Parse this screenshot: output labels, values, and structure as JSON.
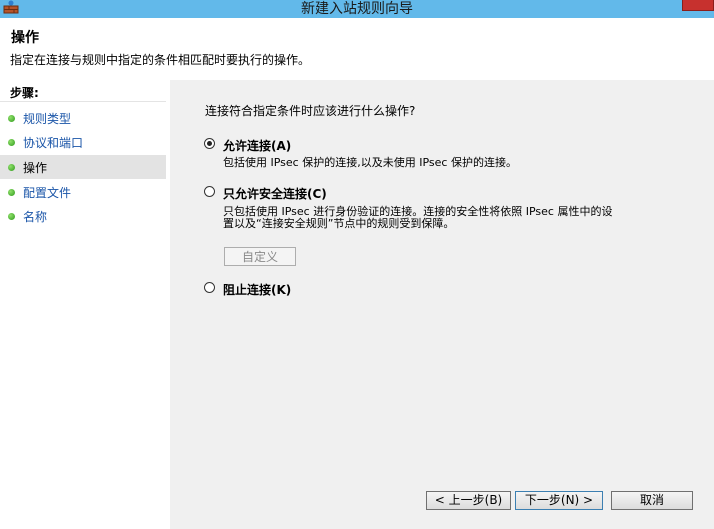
{
  "window": {
    "title": "新建入站规则向导"
  },
  "header": {
    "title": "操作",
    "description": "指定在连接与规则中指定的条件相匹配时要执行的操作。"
  },
  "sidebar": {
    "title": "步骤:",
    "items": [
      {
        "label": "规则类型"
      },
      {
        "label": "协议和端口"
      },
      {
        "label": "操作"
      },
      {
        "label": "配置文件"
      },
      {
        "label": "名称"
      }
    ]
  },
  "main": {
    "question": "连接符合指定条件时应该进行什么操作?",
    "options": [
      {
        "label": "允许连接(A)",
        "description": "包括使用 IPsec 保护的连接,以及未使用 IPsec 保护的连接。",
        "selected": true
      },
      {
        "label": "只允许安全连接(C)",
        "description_line1": "只包括使用 IPsec 进行身份验证的连接。连接的安全性将依照 IPsec 属性中的设",
        "description_line2": "置以及“连接安全规则”节点中的规则受到保障。",
        "selected": false
      },
      {
        "label": "阻止连接(K)",
        "selected": false
      }
    ],
    "customize_label": "自定义"
  },
  "buttons": {
    "back": "< 上一步(B)",
    "next": "下一步(N) >",
    "cancel": "取消"
  }
}
